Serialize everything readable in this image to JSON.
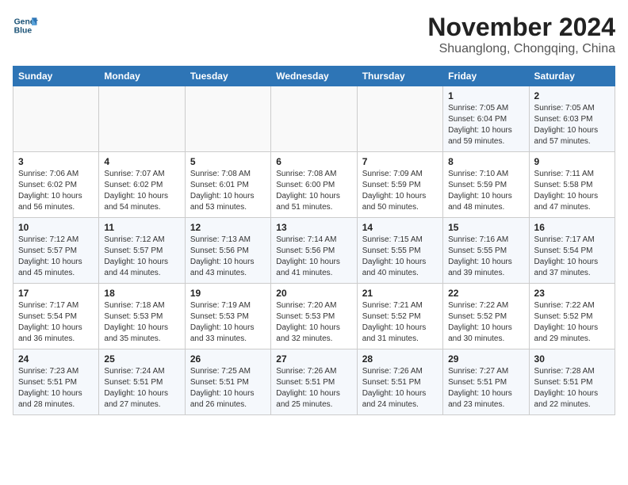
{
  "logo": {
    "line1": "General",
    "line2": "Blue"
  },
  "title": "November 2024",
  "subtitle": "Shuanglong, Chongqing, China",
  "days_of_week": [
    "Sunday",
    "Monday",
    "Tuesday",
    "Wednesday",
    "Thursday",
    "Friday",
    "Saturday"
  ],
  "weeks": [
    [
      {
        "day": "",
        "info": ""
      },
      {
        "day": "",
        "info": ""
      },
      {
        "day": "",
        "info": ""
      },
      {
        "day": "",
        "info": ""
      },
      {
        "day": "",
        "info": ""
      },
      {
        "day": "1",
        "info": "Sunrise: 7:05 AM\nSunset: 6:04 PM\nDaylight: 10 hours and 59 minutes."
      },
      {
        "day": "2",
        "info": "Sunrise: 7:05 AM\nSunset: 6:03 PM\nDaylight: 10 hours and 57 minutes."
      }
    ],
    [
      {
        "day": "3",
        "info": "Sunrise: 7:06 AM\nSunset: 6:02 PM\nDaylight: 10 hours and 56 minutes."
      },
      {
        "day": "4",
        "info": "Sunrise: 7:07 AM\nSunset: 6:02 PM\nDaylight: 10 hours and 54 minutes."
      },
      {
        "day": "5",
        "info": "Sunrise: 7:08 AM\nSunset: 6:01 PM\nDaylight: 10 hours and 53 minutes."
      },
      {
        "day": "6",
        "info": "Sunrise: 7:08 AM\nSunset: 6:00 PM\nDaylight: 10 hours and 51 minutes."
      },
      {
        "day": "7",
        "info": "Sunrise: 7:09 AM\nSunset: 5:59 PM\nDaylight: 10 hours and 50 minutes."
      },
      {
        "day": "8",
        "info": "Sunrise: 7:10 AM\nSunset: 5:59 PM\nDaylight: 10 hours and 48 minutes."
      },
      {
        "day": "9",
        "info": "Sunrise: 7:11 AM\nSunset: 5:58 PM\nDaylight: 10 hours and 47 minutes."
      }
    ],
    [
      {
        "day": "10",
        "info": "Sunrise: 7:12 AM\nSunset: 5:57 PM\nDaylight: 10 hours and 45 minutes."
      },
      {
        "day": "11",
        "info": "Sunrise: 7:12 AM\nSunset: 5:57 PM\nDaylight: 10 hours and 44 minutes."
      },
      {
        "day": "12",
        "info": "Sunrise: 7:13 AM\nSunset: 5:56 PM\nDaylight: 10 hours and 43 minutes."
      },
      {
        "day": "13",
        "info": "Sunrise: 7:14 AM\nSunset: 5:56 PM\nDaylight: 10 hours and 41 minutes."
      },
      {
        "day": "14",
        "info": "Sunrise: 7:15 AM\nSunset: 5:55 PM\nDaylight: 10 hours and 40 minutes."
      },
      {
        "day": "15",
        "info": "Sunrise: 7:16 AM\nSunset: 5:55 PM\nDaylight: 10 hours and 39 minutes."
      },
      {
        "day": "16",
        "info": "Sunrise: 7:17 AM\nSunset: 5:54 PM\nDaylight: 10 hours and 37 minutes."
      }
    ],
    [
      {
        "day": "17",
        "info": "Sunrise: 7:17 AM\nSunset: 5:54 PM\nDaylight: 10 hours and 36 minutes."
      },
      {
        "day": "18",
        "info": "Sunrise: 7:18 AM\nSunset: 5:53 PM\nDaylight: 10 hours and 35 minutes."
      },
      {
        "day": "19",
        "info": "Sunrise: 7:19 AM\nSunset: 5:53 PM\nDaylight: 10 hours and 33 minutes."
      },
      {
        "day": "20",
        "info": "Sunrise: 7:20 AM\nSunset: 5:53 PM\nDaylight: 10 hours and 32 minutes."
      },
      {
        "day": "21",
        "info": "Sunrise: 7:21 AM\nSunset: 5:52 PM\nDaylight: 10 hours and 31 minutes."
      },
      {
        "day": "22",
        "info": "Sunrise: 7:22 AM\nSunset: 5:52 PM\nDaylight: 10 hours and 30 minutes."
      },
      {
        "day": "23",
        "info": "Sunrise: 7:22 AM\nSunset: 5:52 PM\nDaylight: 10 hours and 29 minutes."
      }
    ],
    [
      {
        "day": "24",
        "info": "Sunrise: 7:23 AM\nSunset: 5:51 PM\nDaylight: 10 hours and 28 minutes."
      },
      {
        "day": "25",
        "info": "Sunrise: 7:24 AM\nSunset: 5:51 PM\nDaylight: 10 hours and 27 minutes."
      },
      {
        "day": "26",
        "info": "Sunrise: 7:25 AM\nSunset: 5:51 PM\nDaylight: 10 hours and 26 minutes."
      },
      {
        "day": "27",
        "info": "Sunrise: 7:26 AM\nSunset: 5:51 PM\nDaylight: 10 hours and 25 minutes."
      },
      {
        "day": "28",
        "info": "Sunrise: 7:26 AM\nSunset: 5:51 PM\nDaylight: 10 hours and 24 minutes."
      },
      {
        "day": "29",
        "info": "Sunrise: 7:27 AM\nSunset: 5:51 PM\nDaylight: 10 hours and 23 minutes."
      },
      {
        "day": "30",
        "info": "Sunrise: 7:28 AM\nSunset: 5:51 PM\nDaylight: 10 hours and 22 minutes."
      }
    ]
  ]
}
